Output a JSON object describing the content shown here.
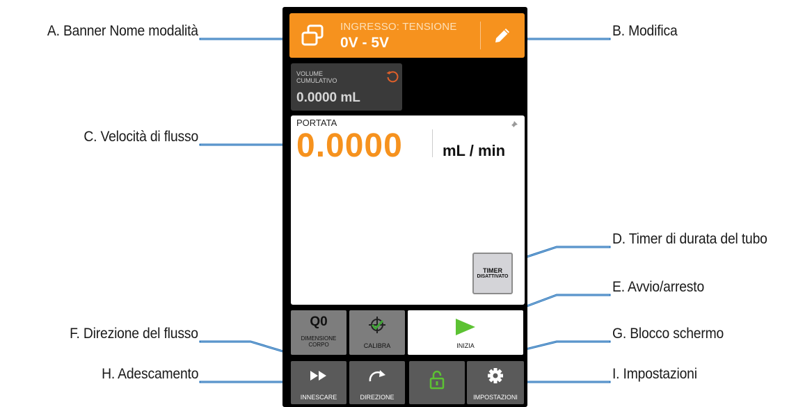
{
  "callouts": {
    "a": "A. Banner Nome modalità",
    "b": "B. Modifica",
    "c": "C. Velocità di flusso",
    "d": "D. Timer di durata del tubo",
    "e": "E. Avvio/arresto",
    "f": "F. Direzione del flusso",
    "g": "G. Blocco schermo",
    "h": "H. Adescamento",
    "i": "I. Impostazioni"
  },
  "colors": {
    "leader_line": "#1f6fb8",
    "banner": "#f6921e",
    "flow_value": "#f6921e",
    "start_icon": "#5cc233",
    "lock_icon": "#5cc233",
    "calibrate_check": "#3fa535"
  },
  "screen": {
    "banner": {
      "icon": "mode-icon",
      "subtitle": "INGRESSO: TENSIONE",
      "title": "0V - 5V",
      "edit_icon": "pencil-icon"
    },
    "volume": {
      "label": "VOLUME CUMULATIVO",
      "value": "0.0000 mL",
      "reset_icon": "reset-icon"
    },
    "flow": {
      "label": "PORTATA",
      "value": "0.0000",
      "unit": "mL / min",
      "pin_icon": "pin-icon"
    },
    "timer": {
      "line1": "TIMER",
      "line2": "DISATTIVATO"
    },
    "buttons": {
      "tube_size_value": "Q0",
      "tube_size_label": "DIMENSIONE CORPO",
      "calibrate": "CALIBRA",
      "start": "INIZIA",
      "prime": "INNESCARE",
      "direction": "DIREZIONE",
      "settings": "IMPOSTAZIONI"
    }
  }
}
